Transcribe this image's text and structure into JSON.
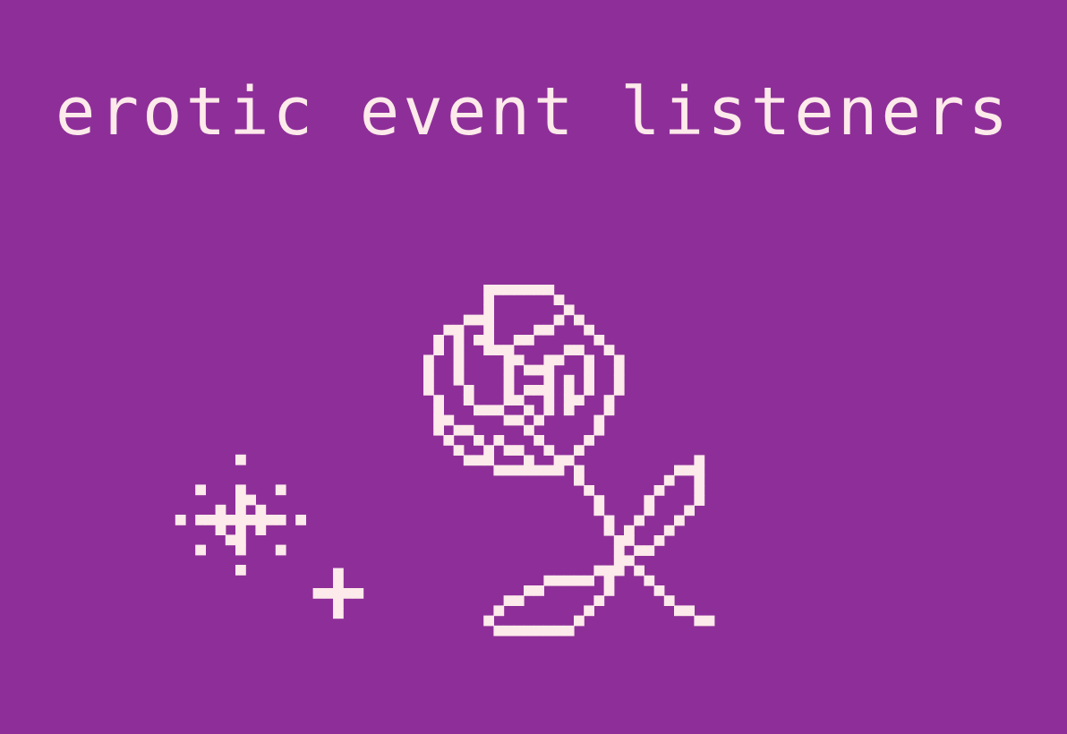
{
  "title": "erotic event listeners",
  "colors": {
    "background": "#8e2f99",
    "foreground": "#fdeaea"
  },
  "icons": {
    "rose": "rose-icon",
    "sparkle_large": "sparkle-large-icon",
    "sparkle_small": "sparkle-small-icon"
  }
}
